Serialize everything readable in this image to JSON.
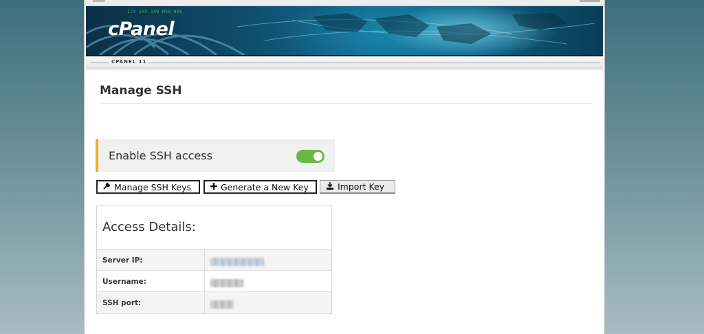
{
  "header": {
    "logo_text": "cPanel",
    "version_label": "CPANEL 11"
  },
  "page": {
    "title": "Manage SSH"
  },
  "ssh_access": {
    "label": "Enable SSH access",
    "enabled": true,
    "accent_color": "#f0ad1e",
    "toggle_color": "#6cb644"
  },
  "buttons": [
    {
      "label": "Manage SSH Keys",
      "icon": "wrench-icon"
    },
    {
      "label": "Generate a New Key",
      "icon": "plus-icon"
    },
    {
      "label": "Import Key",
      "icon": "import-icon"
    }
  ],
  "access_details": {
    "heading": "Access Details:",
    "rows": [
      {
        "label": "Server IP:",
        "value": "[redacted]"
      },
      {
        "label": "Username:",
        "value": "[redacted]"
      },
      {
        "label": "SSH port:",
        "value": "[redacted]"
      }
    ]
  }
}
